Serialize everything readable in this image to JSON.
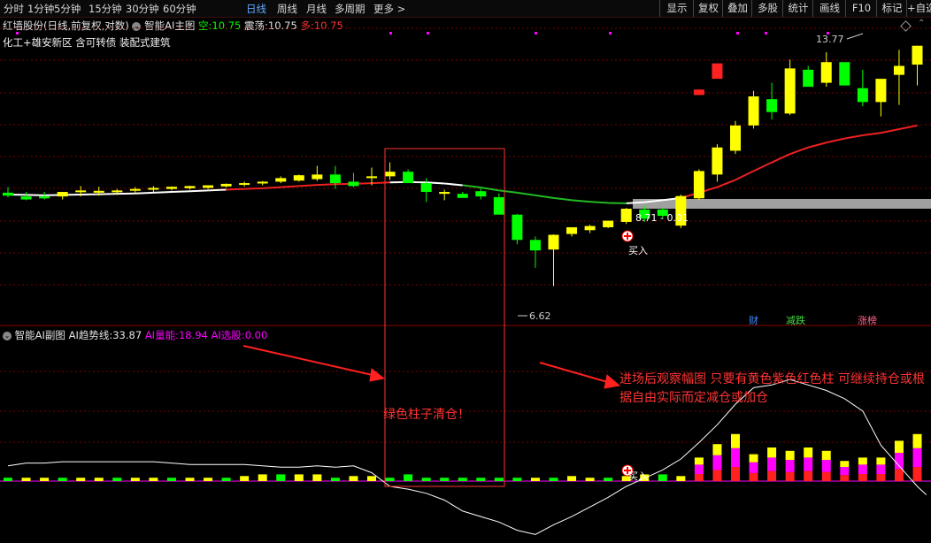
{
  "toolbar": {
    "timeframes": [
      "分时",
      "1分钟",
      "5分钟",
      "15分钟",
      "30分钟",
      "60分钟",
      "日线",
      "周线",
      "月线",
      "多周期",
      "更多 >"
    ],
    "active": "日线",
    "buttons": [
      "显示",
      "复权",
      "叠加",
      "多股",
      "统计",
      "画线",
      "F10",
      "标记",
      "+自选"
    ]
  },
  "main": {
    "stock": "红墙股份(日线,前复权,对数)",
    "indicator": "智能AI主图",
    "kong_label": "空:",
    "kong_value": "10.75",
    "zhen_label": "震荡:",
    "zhen_value": "10.75",
    "duo_label": "多:",
    "duo_value": "10.75",
    "concepts": "化工+雄安新区 含可转债 装配式建筑",
    "high_label": "13.77",
    "low_label": "6.62",
    "level_label": "8.71 - 0.01",
    "buy_label": "买入",
    "markers": [
      "财",
      "减跌",
      "涨榜"
    ]
  },
  "sub": {
    "indicator": "智能AI副图",
    "trend_label": "AI趋势线:",
    "trend_value": "33.87",
    "energy_label": "AI量能:",
    "energy_value": "18.94",
    "pick_label": "AI选股:",
    "pick_value": "0.00",
    "buy_label": "买入"
  },
  "annotations": {
    "green_clear": "绿色柱子清仓！",
    "advice": "进场后观察幅图 只要有黄色紫色红色柱 可继续持仓或根据自由实际而定减仓或加仓"
  },
  "colors": {
    "up": "#ffff00",
    "down": "#00ff00",
    "red": "#ff2020",
    "magenta": "#ff00ff",
    "white": "#ffffff",
    "annotation": "#ff3333",
    "grid": "#7a0000"
  },
  "chart_data": [
    {
      "type": "candlestick",
      "ylim": [
        6.0,
        14.6
      ],
      "x": [
        1,
        2,
        3,
        4,
        5,
        6,
        7,
        8,
        9,
        10,
        11,
        12,
        13,
        14,
        15,
        16,
        17,
        18,
        19,
        20,
        21,
        22,
        23,
        24,
        25,
        26,
        27,
        28,
        29,
        30,
        31,
        32,
        33,
        34,
        35,
        36,
        37,
        38,
        39,
        40,
        41,
        42,
        43,
        44,
        45,
        46,
        47,
        48
      ],
      "open": [
        8.8,
        8.7,
        8.7,
        8.7,
        8.82,
        8.8,
        8.82,
        8.86,
        8.88,
        8.9,
        8.92,
        8.93,
        8.97,
        9.02,
        9.05,
        9.1,
        9.13,
        9.17,
        9.3,
        9.1,
        9.2,
        9.25,
        9.38,
        9.06,
        8.77,
        8.77,
        8.84,
        8.68,
        8.23,
        7.62,
        7.4,
        7.76,
        7.85,
        7.92,
        8.05,
        8.36,
        8.36,
        7.96,
        8.65,
        9.3,
        10.0,
        10.8,
        11.7,
        11.2,
        12.8,
        12.3,
        13.1,
        12.1,
        11.6,
        12.6,
        13.0
      ],
      "high": [
        8.95,
        8.82,
        8.82,
        8.82,
        8.98,
        8.96,
        8.9,
        8.95,
        8.98,
        8.97,
        8.99,
        9.0,
        9.05,
        9.1,
        9.12,
        9.25,
        9.3,
        9.55,
        9.55,
        9.35,
        9.5,
        9.65,
        9.45,
        9.2,
        8.88,
        8.82,
        8.92,
        8.78,
        8.25,
        7.7,
        7.75,
        7.9,
        7.98,
        8.08,
        8.4,
        8.45,
        8.4,
        8.75,
        9.45,
        10.2,
        10.95,
        12.0,
        12.3,
        13.2,
        12.95,
        13.5,
        12.8,
        12.8,
        11.8,
        13.6,
        13.77
      ],
      "low": [
        8.68,
        8.6,
        8.62,
        8.62,
        8.7,
        8.72,
        8.74,
        8.8,
        8.82,
        8.86,
        8.88,
        8.9,
        8.94,
        8.97,
        9.0,
        9.06,
        9.1,
        9.12,
        8.9,
        8.95,
        9.0,
        9.15,
        9.2,
        8.55,
        8.6,
        8.7,
        8.62,
        8.55,
        7.52,
        7.0,
        6.62,
        7.7,
        7.78,
        7.9,
        8.0,
        8.05,
        8.15,
        7.9,
        8.6,
        9.1,
        9.9,
        10.7,
        11.0,
        11.15,
        12.3,
        12.15,
        12.4,
        11.45,
        11.1,
        11.5,
        12.2
      ],
      "close": [
        8.72,
        8.62,
        8.65,
        8.82,
        8.86,
        8.85,
        8.86,
        8.9,
        8.93,
        8.96,
        8.98,
        9.0,
        9.04,
        9.06,
        9.1,
        9.2,
        9.28,
        9.3,
        9.06,
        8.98,
        9.25,
        9.38,
        9.06,
        8.82,
        8.82,
        8.66,
        8.7,
        8.23,
        7.62,
        7.38,
        7.74,
        7.92,
        7.95,
        8.08,
        8.38,
        8.13,
        8.2,
        8.71,
        9.4,
        10.1,
        10.8,
        11.8,
        11.25,
        12.85,
        12.15,
        13.1,
        12.2,
        11.6,
        12.45,
        12.95,
        13.77
      ],
      "ma": [
        8.75,
        8.74,
        8.73,
        8.74,
        8.75,
        8.76,
        8.77,
        8.78,
        8.8,
        8.82,
        8.84,
        8.86,
        8.88,
        8.9,
        8.92,
        8.95,
        8.98,
        9.01,
        9.03,
        9.04,
        9.06,
        9.08,
        9.09,
        9.08,
        9.05,
        9.0,
        8.94,
        8.86,
        8.8,
        8.73,
        8.66,
        8.6,
        8.56,
        8.53,
        8.52,
        8.55,
        8.6,
        8.66,
        8.8,
        8.95,
        9.15,
        9.4,
        9.65,
        9.9,
        10.1,
        10.25,
        10.38,
        10.48,
        10.56,
        10.68,
        10.8
      ],
      "ma_colors": [
        "white",
        "white",
        "white",
        "white",
        "white",
        "white",
        "white",
        "white",
        "white",
        "white",
        "white",
        "white",
        "red",
        "red",
        "red",
        "red",
        "red",
        "red",
        "red",
        "red",
        "red",
        "white",
        "white",
        "white",
        "white",
        "green",
        "green",
        "green",
        "green",
        "green",
        "green",
        "green",
        "green",
        "green",
        "white",
        "white",
        "white",
        "red",
        "red",
        "red",
        "red",
        "red",
        "red",
        "red",
        "red",
        "red",
        "red",
        "red",
        "red",
        "red",
        "red"
      ],
      "level": 8.71
    },
    {
      "type": "bar",
      "series": [
        {
          "color": "mixed",
          "values": [
            2,
            2,
            2,
            2,
            2,
            2,
            2,
            2,
            2,
            2,
            2,
            2,
            2,
            3,
            4,
            4,
            4,
            4,
            2,
            3,
            3,
            2,
            4,
            2,
            2,
            2,
            2,
            2,
            2,
            2,
            2,
            3,
            2,
            2,
            3,
            4,
            4,
            3,
            14,
            22,
            28,
            16,
            20,
            18,
            20,
            18,
            12,
            14,
            14,
            24,
            28
          ]
        },
        {
          "color": "#ffffff",
          "name": "AI趋势线",
          "values": [
            55,
            57,
            57,
            58,
            58,
            58,
            58,
            58,
            58,
            57,
            56,
            56,
            56,
            56,
            55,
            54,
            54,
            55,
            54,
            55,
            50,
            40,
            38,
            35,
            30,
            22,
            18,
            14,
            8,
            5,
            12,
            18,
            25,
            32,
            40,
            46,
            52,
            60,
            72,
            85,
            100,
            112,
            114,
            118,
            114,
            110,
            104,
            95,
            70,
            55,
            40,
            33.87
          ]
        }
      ]
    }
  ]
}
